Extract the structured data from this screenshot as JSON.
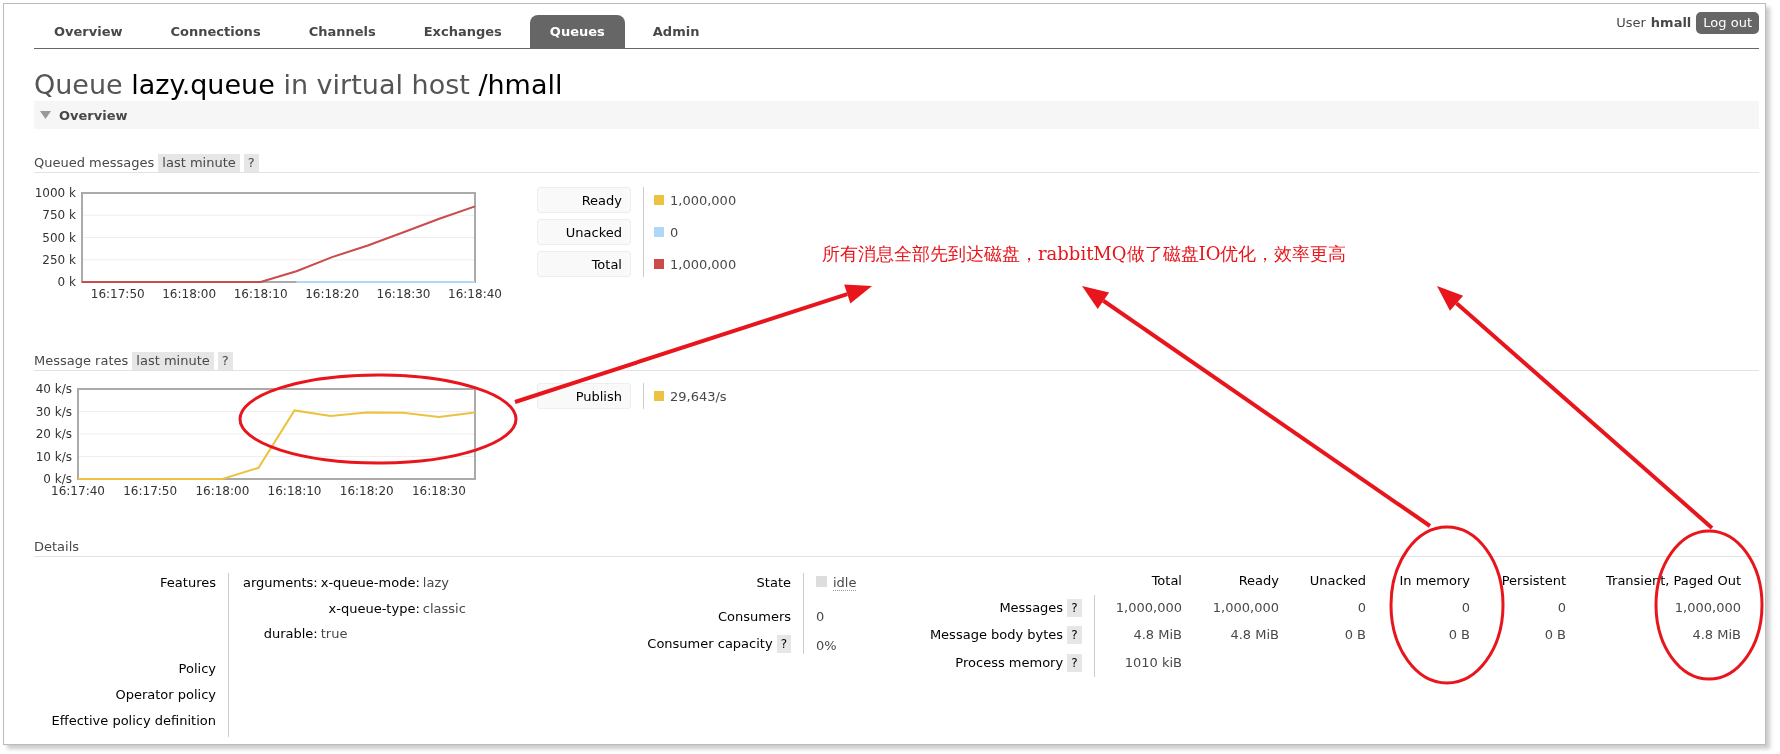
{
  "nav": {
    "tabs": [
      {
        "label": "Overview",
        "selected": false
      },
      {
        "label": "Connections",
        "selected": false
      },
      {
        "label": "Channels",
        "selected": false
      },
      {
        "label": "Exchanges",
        "selected": false
      },
      {
        "label": "Queues",
        "selected": true
      },
      {
        "label": "Admin",
        "selected": false
      }
    ],
    "user_label": "User",
    "user": "hmall",
    "logout": "Log out"
  },
  "title": {
    "prefix": "Queue",
    "name": "lazy.queue",
    "middle": "in virtual host",
    "vhost": "/hmall"
  },
  "section": {
    "title": "Overview",
    "expanded": true
  },
  "queued_messages": {
    "title": "Queued messages",
    "range": "last minute",
    "help": "?",
    "chart_data": {
      "type": "line",
      "categories": [
        null,
        "16:17:50",
        null,
        "16:18:00",
        null,
        "16:18:10",
        null,
        "16:18:20",
        null,
        "16:18:30",
        null,
        "16:18:40"
      ],
      "ylim": [
        0,
        1000000
      ],
      "grid": true,
      "yticks": [
        {
          "value": 0,
          "label": "0 k"
        },
        {
          "value": 250000,
          "label": "250 k"
        },
        {
          "value": 500000,
          "label": "500 k"
        },
        {
          "value": 750000,
          "label": "750 k"
        },
        {
          "value": 1000000,
          "label": "1000 k"
        }
      ],
      "series": [
        {
          "color": "#afd8f8",
          "values": [
            null,
            null,
            null,
            null,
            null,
            null,
            0,
            0,
            0,
            0,
            0,
            0
          ]
        },
        {
          "color": "#cb4b4b",
          "values": [
            0,
            0,
            0,
            0,
            0,
            0,
            120000,
            280000,
            410000,
            560000,
            710000,
            850000
          ]
        }
      ]
    },
    "legend": [
      {
        "label": "Ready",
        "color": "#edc240",
        "value": "1,000,000"
      },
      {
        "label": "Unacked",
        "color": "#afd8f8",
        "value": "0"
      },
      {
        "label": "Total",
        "color": "#cb4b4b",
        "value": "1,000,000"
      }
    ]
  },
  "message_rates": {
    "title": "Message rates",
    "range": "last minute",
    "help": "?",
    "chart_data": {
      "type": "line",
      "categories": [
        "16:17:40",
        null,
        "16:17:50",
        null,
        "16:18:00",
        null,
        "16:18:10",
        null,
        "16:18:20",
        null,
        "16:18:30",
        null
      ],
      "ylim": [
        0,
        40000
      ],
      "grid": true,
      "yticks": [
        {
          "value": 0,
          "label": "0 k/s"
        },
        {
          "value": 10000,
          "label": "10 k/s"
        },
        {
          "value": 20000,
          "label": "20 k/s"
        },
        {
          "value": 30000,
          "label": "30 k/s"
        },
        {
          "value": 40000,
          "label": "40 k/s"
        }
      ],
      "series": [
        {
          "color": "#edc240",
          "values": [
            0,
            0,
            0,
            0,
            0,
            5000,
            30500,
            28000,
            29500,
            29400,
            27500,
            29600
          ]
        }
      ]
    },
    "legend": [
      {
        "label": "Publish",
        "color": "#edc240",
        "value": "29,643/s"
      }
    ]
  },
  "details": {
    "title": "Details",
    "features_label": "Features",
    "arguments_label": "arguments:",
    "arguments": [
      {
        "key": "x-queue-mode:",
        "value": "lazy"
      },
      {
        "key": "x-queue-type:",
        "value": "classic"
      }
    ],
    "durable_label": "durable:",
    "durable": "true",
    "policy_rows": [
      "Policy",
      "Operator policy",
      "Effective policy definition"
    ],
    "state_label": "State",
    "state": "idle",
    "consumers_label": "Consumers",
    "consumers": "0",
    "capacity_label": "Consumer capacity",
    "capacity_help": "?",
    "capacity": "0%",
    "stats": {
      "columns": [
        "Total",
        "Ready",
        "Unacked",
        "In memory",
        "Persistent",
        "Transient, Paged Out"
      ],
      "rows": [
        {
          "label": "Messages",
          "help": "?",
          "cells": [
            "1,000,000",
            "1,000,000",
            "0",
            "0",
            "0",
            "1,000,000"
          ]
        },
        {
          "label": "Message body bytes",
          "help": "?",
          "cells": [
            "4.8 MiB",
            "4.8 MiB",
            "0 B",
            "0 B",
            "0 B",
            "4.8 MiB"
          ]
        },
        {
          "label": "Process memory",
          "help": "?",
          "cells": [
            "1010 kiB"
          ]
        }
      ]
    }
  },
  "annotation": {
    "text": "所有消息全部先到达磁盘，rabbitMQ做了磁盘IO优化，效率更高"
  }
}
